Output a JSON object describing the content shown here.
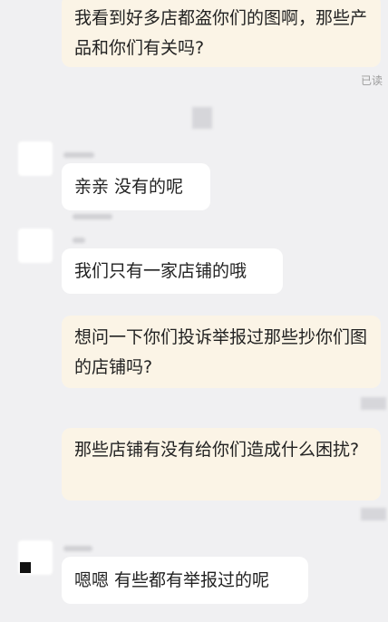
{
  "chat": {
    "read_status": "已读",
    "messages": [
      {
        "side": "out",
        "text": "我看到好多店都盗你们的图啊，那些产品和你们有关吗?"
      },
      {
        "side": "in",
        "text": "亲亲 没有的呢"
      },
      {
        "side": "in",
        "text": "我们只有一家店铺的哦"
      },
      {
        "side": "out",
        "text": "想问一下你们投诉举报过那些抄你们图的店铺吗?"
      },
      {
        "side": "out",
        "text": "那些店铺有没有给你们造成什么困扰?"
      },
      {
        "side": "in",
        "text": "嗯嗯 有些都有举报过的呢"
      }
    ]
  },
  "colors": {
    "background": "#f0f0f2",
    "outgoing_bubble": "#fbf4e6",
    "incoming_bubble": "#ffffff",
    "text": "#222222",
    "read_status": "#9b9b9b"
  }
}
